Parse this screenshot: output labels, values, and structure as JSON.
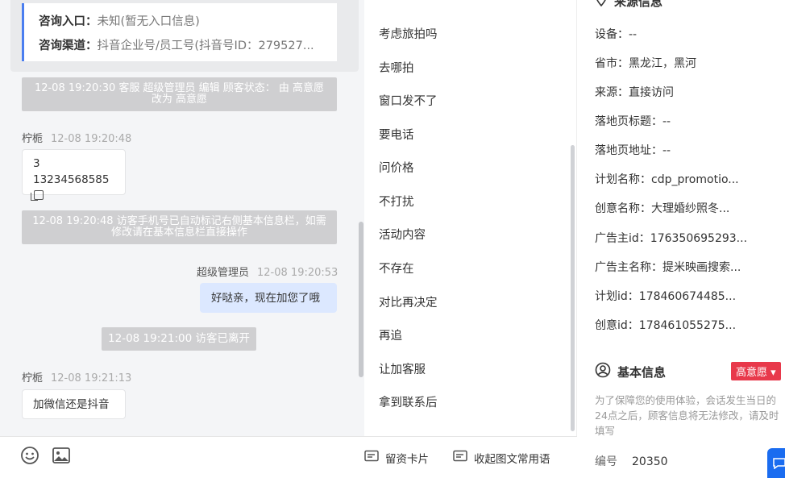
{
  "chat": {
    "info_card": {
      "entry_label": "咨询入口：",
      "entry_value": "未知(暂无入口信息)",
      "channel_label": "咨询渠道：",
      "channel_value": "抖音企业号/员工号(抖音号ID：279527..."
    },
    "sys_status": "12-08 19:20:30 客服 超级管理员 编辑 顾客状态： 由 高意愿 改为 高意愿",
    "msg1": {
      "name": "柠栀",
      "time": "12-08 19:20:48",
      "line1": "3",
      "line2": "13234568585"
    },
    "sys_phone": "12-08 19:20:48 访客手机号已自动标记右侧基本信息栏，如需修改请在基本信息栏直接操作",
    "msg2": {
      "name": "超级管理员",
      "time": "12-08 19:20:53",
      "text": "好哒亲，现在加您了哦"
    },
    "sys_leave": "12-08 19:21:00 访客已离开",
    "msg3": {
      "name": "柠栀",
      "time": "12-08 19:21:13",
      "text": "加微信还是抖音"
    }
  },
  "quick_replies": {
    "items": [
      "考虑旅拍吗",
      "去哪拍",
      "窗口发不了",
      "要电话",
      "问价格",
      "不打扰",
      "活动内容",
      "不存在",
      "对比再决定",
      "再追",
      "让加客服",
      "拿到联系后"
    ],
    "card_btn": "留资卡片",
    "fold_btn": "收起图文常用语"
  },
  "source": {
    "title": "来源信息",
    "rows": [
      {
        "label": "设备：",
        "value": "--"
      },
      {
        "label": "省市：",
        "value": "黑龙江，黑河"
      },
      {
        "label": "来源：",
        "value": "直接访问"
      },
      {
        "label": "落地页标题：",
        "value": "--"
      },
      {
        "label": "落地页地址：",
        "value": "--"
      },
      {
        "label": "计划名称：",
        "value": "cdp_promotio..."
      },
      {
        "label": "创意名称：",
        "value": "大理婚纱照冬..."
      },
      {
        "label": "广告主id：",
        "value": "176350695293..."
      },
      {
        "label": "广告主名称：",
        "value": "提米映画搜索..."
      },
      {
        "label": "计划id：",
        "value": "178460674485..."
      },
      {
        "label": "创意id：",
        "value": "178461055275..."
      }
    ]
  },
  "basic": {
    "title": "基本信息",
    "tag": "高意愿",
    "tip": "为了保障您的使用体验，会话发生当日的24点之后，顾客信息将无法修改，请及时填写",
    "id_label": "编号",
    "id_value": "20350"
  },
  "colors": {
    "accent": "#4a7ef0",
    "tag": "#e8394b",
    "system_bg": "#cfcfd1",
    "my_bubble": "#dce8ff"
  },
  "icons": [
    "emoji-icon",
    "image-icon",
    "card-icon",
    "fold-icon",
    "location-icon",
    "user-circle-icon",
    "caret-down-icon",
    "chat-float-icon"
  ]
}
